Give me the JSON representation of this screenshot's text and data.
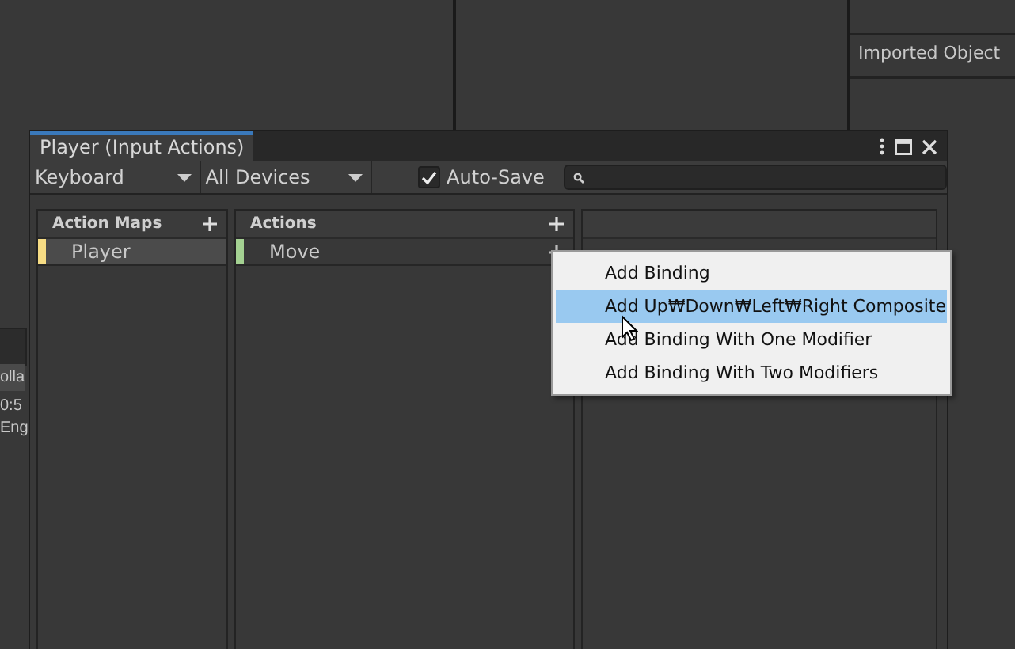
{
  "background": {
    "inspector_label": "Imported Object",
    "side_texts": [
      "olla",
      "0:5",
      "Eng"
    ]
  },
  "window": {
    "title": "Player (Input Actions)"
  },
  "toolbar": {
    "control_scheme": "Keyboard",
    "device": "All Devices",
    "auto_save": {
      "label": "Auto-Save",
      "checked": true
    }
  },
  "panes": [
    {
      "title": "Action Maps",
      "items": [
        {
          "label": "Player",
          "color": "#f6dc84",
          "selected": true
        }
      ]
    },
    {
      "title": "Actions",
      "items": [
        {
          "label": "Move",
          "color": "#a4d192",
          "selected": false
        }
      ]
    }
  ],
  "context_menu": {
    "items": [
      {
        "label": "Add Binding",
        "selected": false
      },
      {
        "label": "Add Up₩Down₩Left₩Right Composite",
        "selected": true
      },
      {
        "label": "Add Binding With One Modifier",
        "selected": false
      },
      {
        "label": "Add Binding With Two Modifiers",
        "selected": false
      }
    ]
  }
}
